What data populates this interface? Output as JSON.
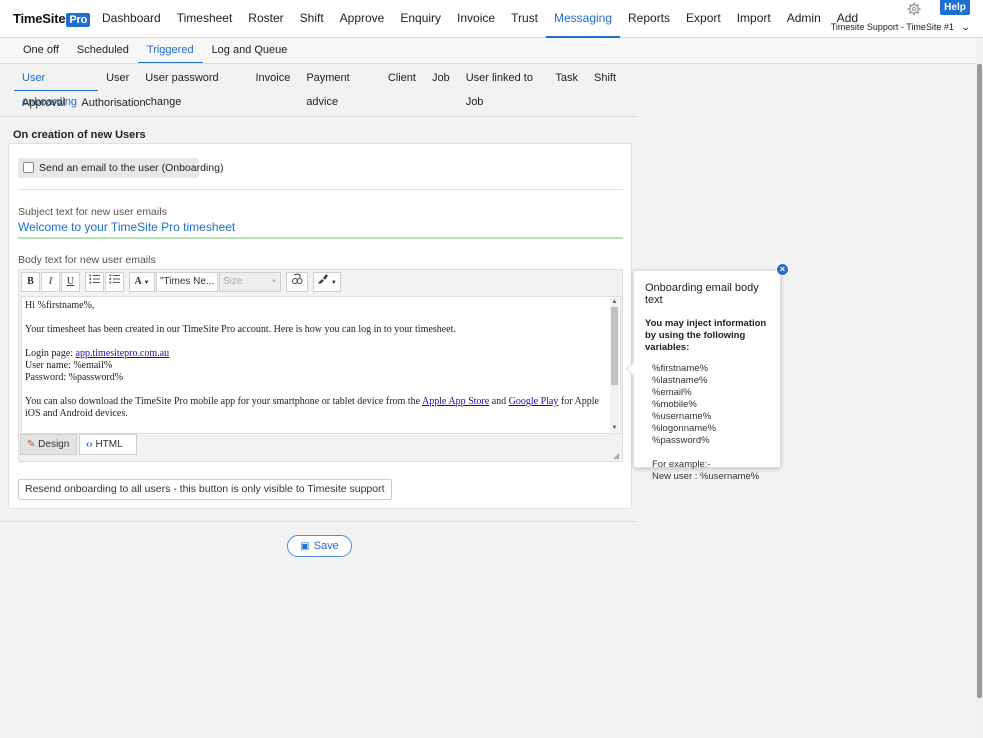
{
  "app": {
    "logo_text": "TimeSite",
    "logo_badge": "Pro",
    "help_label": "Help",
    "account_label": "Timesite Support - TimeSite #1",
    "settings_icon": "gear-icon"
  },
  "nav": {
    "items": [
      "Dashboard",
      "Timesheet",
      "Roster",
      "Shift",
      "Approve",
      "Enquiry",
      "Invoice",
      "Trust",
      "Messaging",
      "Reports",
      "Export",
      "Import",
      "Admin",
      "Add"
    ],
    "active": "Messaging"
  },
  "subtabs": {
    "items": [
      "One off",
      "Scheduled",
      "Triggered",
      "Log and Queue"
    ],
    "active": "Triggered"
  },
  "categories": {
    "row1": [
      "User onboarding",
      "User",
      "User password change",
      "Invoice",
      "Payment advice",
      "Client",
      "Job",
      "User linked to Job",
      "Task",
      "Shift"
    ],
    "row2": [
      "Approval",
      "Authorisation"
    ],
    "active": "User onboarding"
  },
  "section": {
    "title": "On creation of new Users",
    "checkbox_label": "Send an email to the user (Onboarding)",
    "checkbox_checked": false,
    "subject_label": "Subject text for new user emails",
    "subject_value": "Welcome to your TimeSite Pro timesheet",
    "body_label": "Body text for new user emails"
  },
  "editor": {
    "toolbar": {
      "bold": "B",
      "italic": "I",
      "underline": "U",
      "ordered_list_icon": "ordered-list-icon",
      "bullet_list_icon": "bullet-list-icon",
      "font_color": "A",
      "font_name": "\"Times Ne...",
      "font_size": "Size"
    },
    "body": {
      "greeting": "Hi %firstname%,",
      "intro": "Your timesheet has been created in our TimeSite Pro account. Here is how you can log in to your timesheet.",
      "login_prefix": "Login page: ",
      "login_link": "app.timesitepro.com.au",
      "username_line": "User name: %email%",
      "password_line": "Password: %password%",
      "app_prefix": "You can also download the TimeSite Pro mobile app for your smartphone or tablet device from the ",
      "apple_link": "Apple App Store",
      "and": " and ",
      "google_link": "Google Play",
      "app_suffix": " for Apple iOS and Android devices."
    },
    "modes": [
      "Design",
      "HTML"
    ],
    "active_mode": "Design"
  },
  "resend_label": "Resend onboarding to all users - this button is only visible to Timesite support",
  "save_label": "Save",
  "tooltip": {
    "title": "Onboarding email body text",
    "intro_line1": "You may inject information",
    "intro_line2": "by using the following variables:",
    "variables": [
      "%firstname%",
      "%lastname%",
      "%email%",
      "%mobile%",
      "%username%",
      "%logonname%",
      "%password%"
    ],
    "example_label": "For example:-",
    "example_value": "New user : %username%"
  },
  "colors": {
    "accent": "#1e6fd0",
    "subject_underline": "#b7e0b7"
  }
}
